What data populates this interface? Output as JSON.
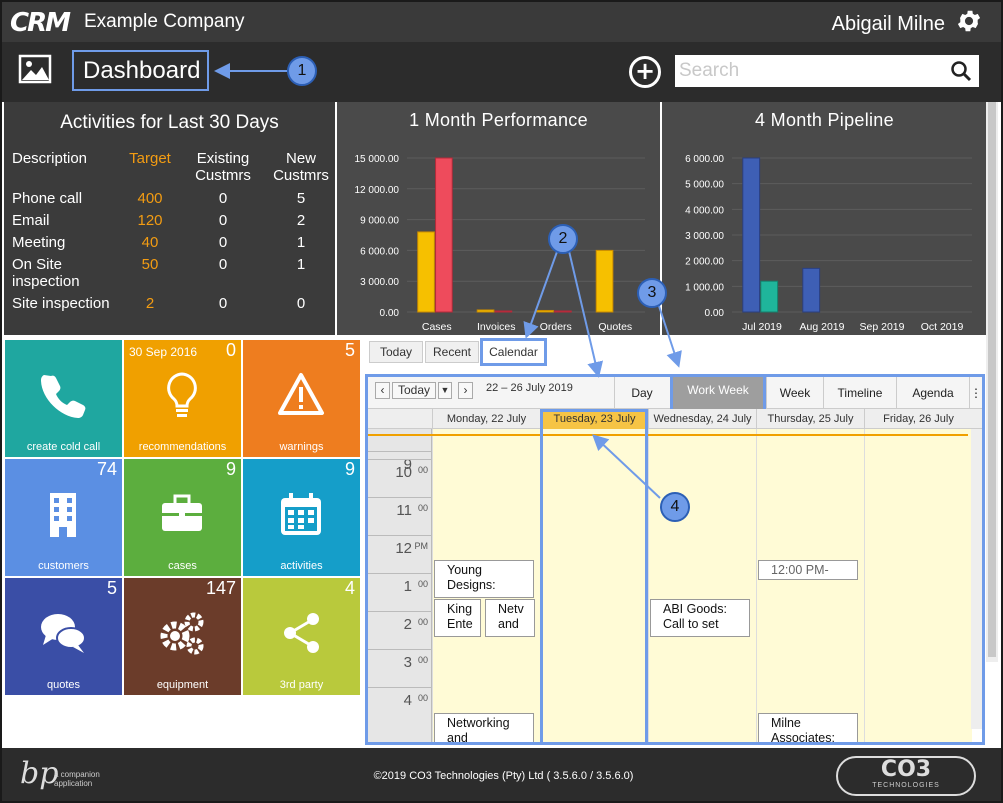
{
  "header": {
    "logo": "CRM",
    "company": "Example Company",
    "user": "Abigail Milne"
  },
  "subbar": {
    "title": "Dashboard",
    "search_placeholder": "Search"
  },
  "activities": {
    "title": "Activities for Last 30 Days",
    "columns": [
      "Description",
      "Target",
      "Existing Custmrs",
      "New Custmrs"
    ],
    "rows": [
      {
        "desc": "Phone call",
        "target": "400",
        "existing": "0",
        "new": "5"
      },
      {
        "desc": "Email",
        "target": "120",
        "existing": "0",
        "new": "2"
      },
      {
        "desc": "Meeting",
        "target": "40",
        "existing": "0",
        "new": "1"
      },
      {
        "desc": "On Site inspection",
        "target": "50",
        "existing": "0",
        "new": "1"
      },
      {
        "desc": "Site inspection",
        "target": "2",
        "existing": "0",
        "new": "0"
      }
    ]
  },
  "chart_data": [
    {
      "type": "bar",
      "title": "1 Month Performance",
      "categories": [
        "Cases",
        "Invoices",
        "Orders",
        "Quotes"
      ],
      "series": [
        {
          "values": [
            7800,
            200,
            150,
            6000
          ]
        },
        {
          "values": [
            15000,
            100,
            100,
            0
          ]
        }
      ],
      "yticks": [
        "15 000.00",
        "12 000.00",
        "9 000.00",
        "6 000.00",
        "3 000.00",
        "0.00"
      ],
      "ylim": [
        0,
        15000
      ]
    },
    {
      "type": "bar",
      "title": "4 Month Pipeline",
      "categories": [
        "Jul 2019",
        "Aug 2019",
        "Sep 2019",
        "Oct 2019"
      ],
      "series": [
        {
          "values": [
            6000,
            1700,
            0,
            0
          ]
        },
        {
          "values": [
            1200,
            0,
            0,
            0
          ]
        }
      ],
      "yticks": [
        "6 000.00",
        "5 000.00",
        "4 000.00",
        "3 000.00",
        "2 000.00",
        "1 000.00",
        "0.00"
      ],
      "ylim": [
        0,
        6000
      ]
    }
  ],
  "tiles": [
    {
      "label": "create cold call",
      "count": "",
      "date": "",
      "color": "#1fa7a0"
    },
    {
      "label": "recommendations",
      "count": "0",
      "date": "30 Sep 2016",
      "color": "#f0a000"
    },
    {
      "label": "warnings",
      "count": "5",
      "date": "",
      "color": "#ee7d1f"
    },
    {
      "label": "customers",
      "count": "74",
      "date": "",
      "color": "#5b8fe3"
    },
    {
      "label": "cases",
      "count": "9",
      "date": "",
      "color": "#5cae3e"
    },
    {
      "label": "activities",
      "count": "9",
      "date": "",
      "color": "#159ec9"
    },
    {
      "label": "quotes",
      "count": "5",
      "date": "",
      "color": "#3a4ea6"
    },
    {
      "label": "equipment",
      "count": "147",
      "date": "",
      "color": "#6b3c2a"
    },
    {
      "label": "3rd party",
      "count": "4",
      "date": "",
      "color": "#b9c93c"
    }
  ],
  "tabs": [
    "Today",
    "Recent",
    "Calendar"
  ],
  "calendar": {
    "today_btn": "Today",
    "range": "22 – 26 July 2019",
    "views": [
      "Day",
      "Work Week",
      "Week",
      "Timeline",
      "Agenda"
    ],
    "days": [
      "Monday, 22 July",
      "Tuesday, 23 July",
      "Wednesday, 24 July",
      "Thursday, 25 July",
      "Friday, 26 July"
    ],
    "hours": [
      {
        "h": "9",
        "m": ""
      },
      {
        "h": "10",
        "m": "00"
      },
      {
        "h": "11",
        "m": "00"
      },
      {
        "h": "12",
        "m": "PM"
      },
      {
        "h": "1",
        "m": "00"
      },
      {
        "h": "2",
        "m": "00"
      },
      {
        "h": "3",
        "m": "00"
      },
      {
        "h": "4",
        "m": "00"
      }
    ],
    "events": {
      "e1": "Young Designs:",
      "e2": "King Ente",
      "e3": "Netv and",
      "e4": "ABI Goods: Call to set",
      "e5": "12:00 PM-",
      "e6": "Networking and",
      "e7": "Milne Associates:"
    }
  },
  "footer": {
    "copyright": "©2019 CO3 Technologies (Pty) Ltd ( 3.5.6.0 / 3.5.6.0)",
    "left_logo": "bp",
    "left_text": "a companion application",
    "right_logo": "CO3",
    "right_sub": "TECHNOLOGIES"
  },
  "callouts": [
    "1",
    "2",
    "3",
    "4"
  ]
}
